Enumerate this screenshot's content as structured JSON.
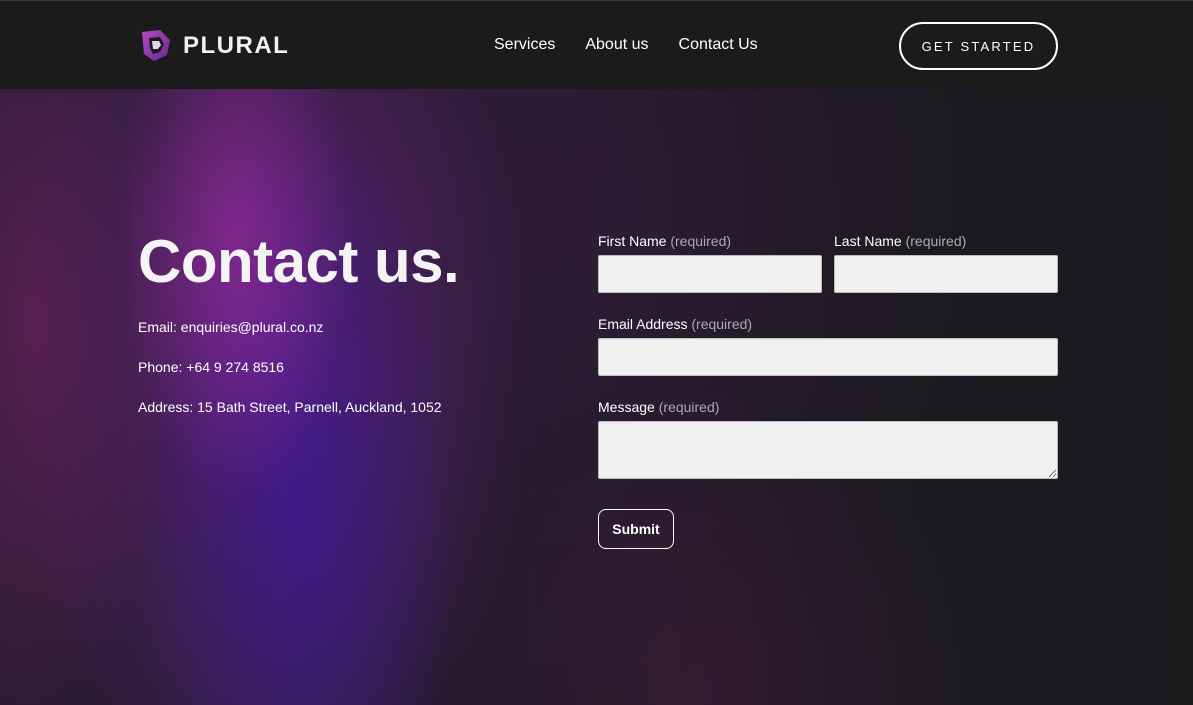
{
  "header": {
    "logo_text": "PLURAL",
    "logo_icon": "plural-shield-logo-icon",
    "nav": [
      {
        "label": "Services"
      },
      {
        "label": "About us"
      },
      {
        "label": "Contact Us"
      }
    ],
    "cta_label": "GET STARTED"
  },
  "contact": {
    "heading": "Contact us.",
    "email": "Email: enquiries@plural.co.nz",
    "phone": "Phone: +64 9 274 8516",
    "address": "Address: 15 Bath Street, Parnell, Auckland, 1052"
  },
  "form": {
    "required_text": "(required)",
    "first_name": {
      "label": "First Name",
      "value": ""
    },
    "last_name": {
      "label": "Last Name",
      "value": ""
    },
    "email": {
      "label": "Email Address",
      "value": ""
    },
    "message": {
      "label": "Message",
      "value": ""
    },
    "submit_label": "Submit"
  },
  "colors": {
    "background": "#1b1b1b",
    "accent_purple": "#8e3aa0",
    "input_bg": "#f0f0f0",
    "required_text": "#a9a9b5"
  }
}
